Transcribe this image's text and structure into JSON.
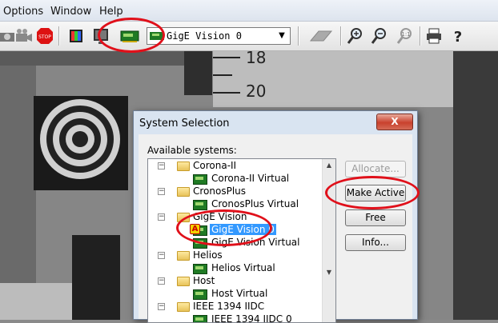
{
  "menu": {
    "options": "Options",
    "window": "Window",
    "help": "Help"
  },
  "toolbar": {
    "board_select_value": "GigE Vision 0"
  },
  "dialog": {
    "title": "System Selection",
    "close_label": "X",
    "available_label": "Available systems:",
    "tree": [
      {
        "group": "Corona-II",
        "child": "Corona-II Virtual"
      },
      {
        "group": "CronosPlus",
        "child": "CronosPlus Virtual"
      },
      {
        "group": "GigE Vision",
        "child": "GigE Vision 0",
        "child2": "GigE Vision Virtual"
      },
      {
        "group": "Helios",
        "child": "Helios Virtual"
      },
      {
        "group": "Host",
        "child": "Host Virtual"
      },
      {
        "group": "IEEE 1394 IIDC",
        "child": "IEEE 1394 IIDC 0"
      }
    ],
    "active_badge": "A",
    "buttons": {
      "allocate": "Allocate...",
      "make_active": "Make Active",
      "free": "Free",
      "info": "Info..."
    }
  },
  "camera": {
    "ruler_18": "18",
    "ruler_20": "20"
  },
  "colors": {
    "annotation": "#e0101a",
    "selection": "#3399ff"
  }
}
